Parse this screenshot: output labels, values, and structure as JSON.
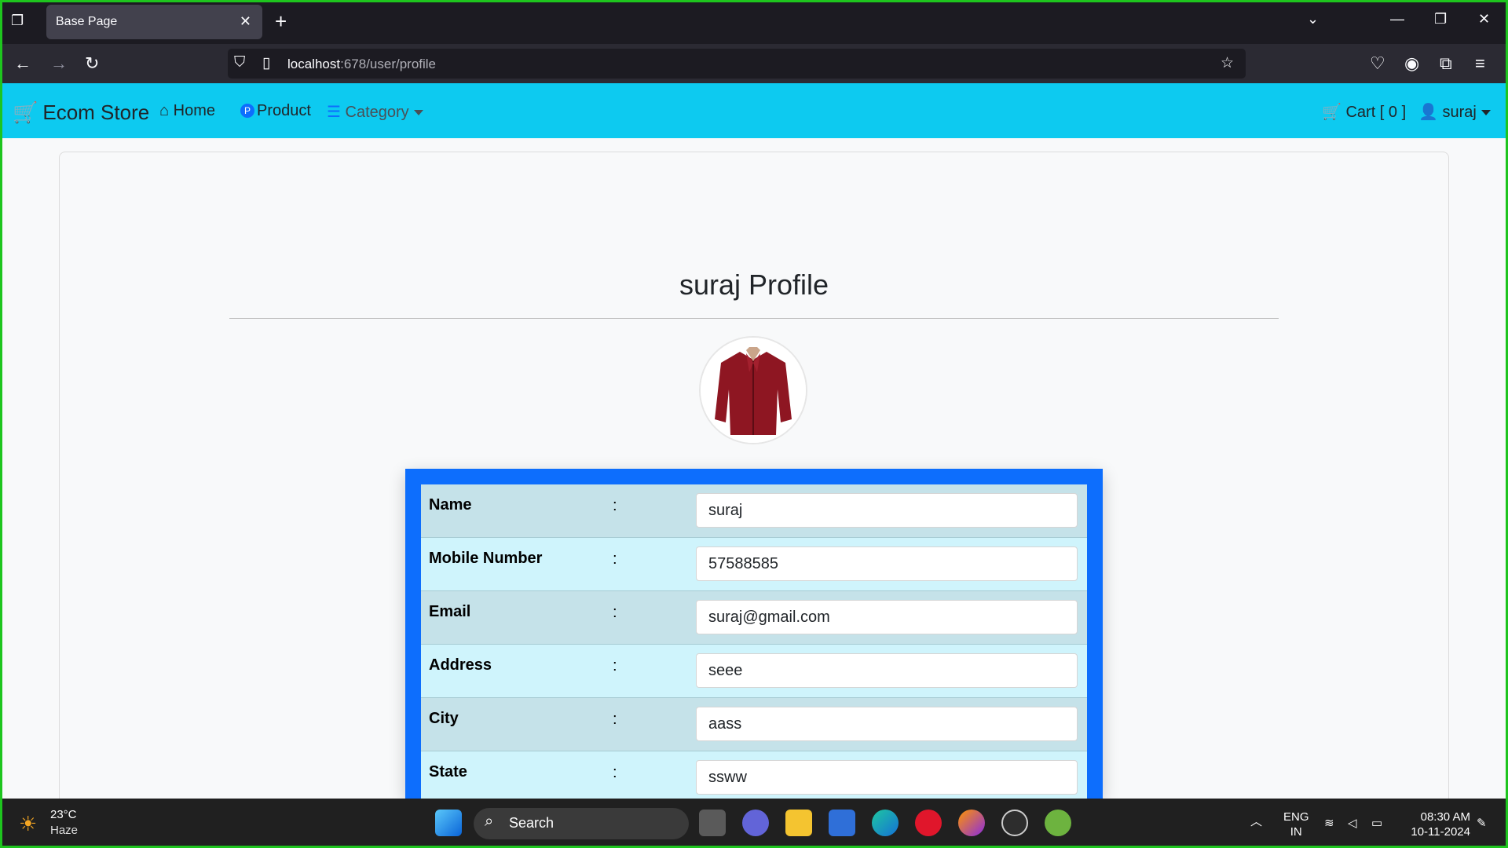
{
  "browser": {
    "tab_title": "Base Page",
    "url_host": "localhost",
    "url_rest": ":678/user/profile"
  },
  "site": {
    "brand": "Ecom Store",
    "nav": {
      "home": "Home",
      "product": "Product",
      "category": "Category",
      "cart": "Cart [ 0 ]",
      "user": "suraj"
    }
  },
  "profile": {
    "title": "suraj Profile",
    "fields": [
      {
        "label": "Name",
        "value": "suraj"
      },
      {
        "label": "Mobile Number",
        "value": "57588585"
      },
      {
        "label": "Email",
        "value": "suraj@gmail.com"
      },
      {
        "label": "Address",
        "value": "seee"
      },
      {
        "label": "City",
        "value": "aass"
      },
      {
        "label": "State",
        "value": "ssww"
      }
    ]
  },
  "taskbar": {
    "temp": "23°C",
    "weather": "Haze",
    "search": "Search",
    "lang1": "ENG",
    "lang2": "IN",
    "time": "08:30 AM",
    "date": "10-11-2024"
  },
  "colors": {
    "navbar": "#0dcaf0",
    "table_border": "#0d6efd"
  }
}
